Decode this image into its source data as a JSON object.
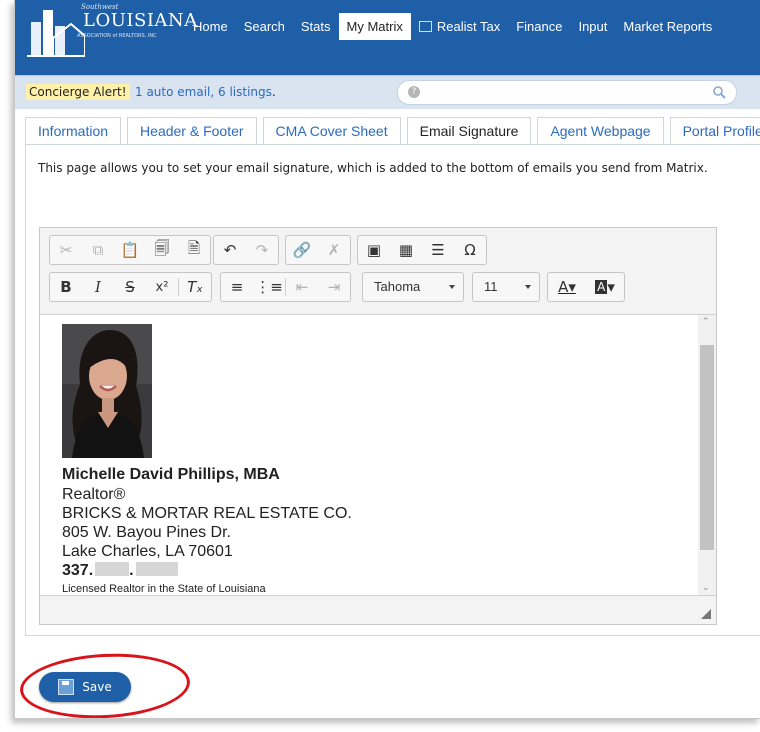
{
  "logo": {
    "top": "Southwest",
    "main": "LOUISIANA",
    "sub": "ASSOCIATION of REALTORS, INC"
  },
  "nav": {
    "items": [
      {
        "label": "Home",
        "active": false
      },
      {
        "label": "Search",
        "active": false
      },
      {
        "label": "Stats",
        "active": false
      },
      {
        "label": "My Matrix",
        "active": true
      },
      {
        "label": "Realist Tax",
        "active": false,
        "icon": "window-icon"
      },
      {
        "label": "Finance",
        "active": false
      },
      {
        "label": "Input",
        "active": false
      },
      {
        "label": "Market Reports",
        "active": false
      }
    ]
  },
  "alert": {
    "badge": "Concierge Alert!",
    "link": "1 auto email, 6 listings",
    "period": "."
  },
  "search": {
    "placeholder": ""
  },
  "tabs": [
    {
      "label": "Information",
      "active": false
    },
    {
      "label": "Header & Footer",
      "active": false
    },
    {
      "label": "CMA Cover Sheet",
      "active": false
    },
    {
      "label": "Email Signature",
      "active": true
    },
    {
      "label": "Agent Webpage",
      "active": false
    },
    {
      "label": "Portal Profile",
      "active": false
    }
  ],
  "description": "This page allows you to set your email signature, which is added to the bottom of emails you send from Matrix.",
  "toolbar": {
    "font": "Tahoma",
    "size": "11"
  },
  "signature": {
    "name": "Michelle David Phillips, MBA",
    "title": "Realtor®",
    "company": "BRICKS & MORTAR REAL ESTATE CO.",
    "address1": "805 W. Bayou Pines Dr.",
    "address2": "Lake Charles, LA  70601",
    "phone_prefix": "337.",
    "phone_dot": ".",
    "license": "Licensed Realtor in the State of Louisiana"
  },
  "save": {
    "label": "Save"
  },
  "colors": {
    "nav_bg": "#1f5fa8",
    "alert_bg": "#d9e4f0",
    "highlight_circle": "#d9131a"
  }
}
